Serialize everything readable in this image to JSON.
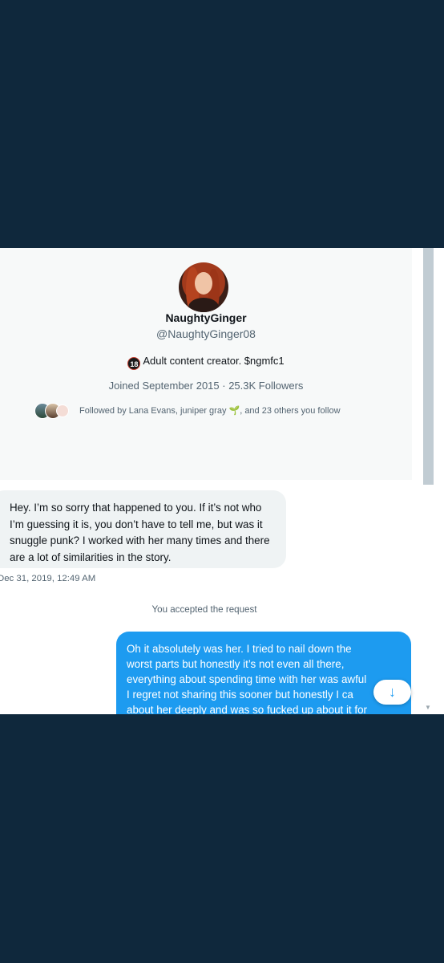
{
  "profile": {
    "display_name": "NaughtyGinger",
    "handle": "@NaughtyGinger08",
    "bio_badge": "18",
    "bio": "Adult content creator. $ngmfc1",
    "joined_followers": "Joined September 2015 · 25.3K Followers",
    "followed_by_prefix": "Followed by Lana Evans, juniper gray ",
    "followed_by_emoji": "🌱",
    "followed_by_suffix": ", and 23 others you follow"
  },
  "conversation": {
    "incoming_message": "Hey. I’m so sorry that happened to you. If it’s not who I’m guessing it is, you don’t have to tell me, but was it snuggle punk? I worked with her many times and there are a lot of similarities in the story.",
    "incoming_timestamp": "Dec 31, 2019, 12:49 AM",
    "system_note": "You accepted the request",
    "outgoing_lines": [
      "Oh it absolutely was her.  I tried to nail down the",
      "worst parts but honestly it’s not even all there,",
      "everything about spending time with her was awful",
      "I regret not sharing this sooner but honestly I ca",
      "about her deeply and was so fucked up about it for"
    ],
    "scroll_down_icon": "↓"
  },
  "colors": {
    "background": "#0f283c",
    "accent": "#1d9bf0"
  }
}
